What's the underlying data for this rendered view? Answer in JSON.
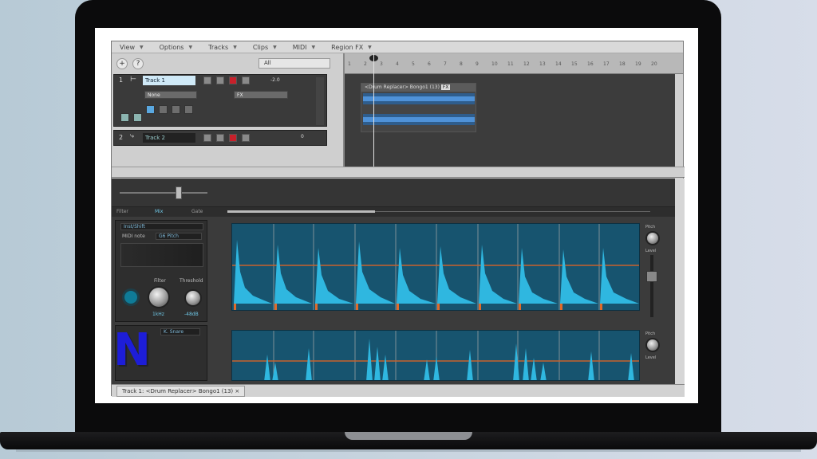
{
  "menu": [
    {
      "label": "View"
    },
    {
      "label": "Options"
    },
    {
      "label": "Tracks"
    },
    {
      "label": "Clips"
    },
    {
      "label": "MIDI"
    },
    {
      "label": "Region FX"
    }
  ],
  "toolbar": {
    "add_label": "+",
    "help_label": "?",
    "filter_value": "All"
  },
  "tracks": [
    {
      "number": "1",
      "name": "Track 1",
      "input": "None",
      "value": "-2.0",
      "fx": "FX"
    },
    {
      "number": "2",
      "name": "Track 2",
      "value": "0"
    }
  ],
  "clip": {
    "title": "<Drum Replacer> Bongo1 (13)",
    "badge": "FX"
  },
  "editor": {
    "tabs": [
      "Filter",
      "Mix",
      "Gate"
    ],
    "row1": {
      "preset": "Inst/Shift",
      "midi_note_label": "MIDI note",
      "midi_note_value": "G6 Pitch",
      "filter_label": "Filter",
      "filter_value": "1kHz",
      "threshold_label": "Threshold",
      "threshold_value": "-48dB",
      "right_labels": [
        "Pitch",
        "Level"
      ]
    },
    "row2": {
      "preset": "K. Snare",
      "right_labels": [
        "Pitch",
        "Level"
      ]
    }
  },
  "status": {
    "tab_label": "Track 1: <Drum Replacer> Bongo1 (13)",
    "close": "×"
  },
  "logo": {
    "letter": "N"
  }
}
